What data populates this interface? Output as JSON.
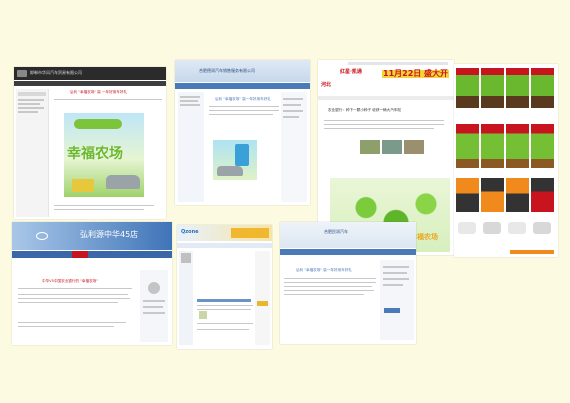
{
  "shot1": {
    "site_name": "邯郸市华风汽车贸易有限公司",
    "headline": "弘利 \"幸福农场\" 赢 一年好用车好礼",
    "banner_title": "幸福农场"
  },
  "shot2": {
    "site_name": "合肥德润汽车销售服务有限公司",
    "headline": "弘利 \"幸福农场\" 赢一年好用车好礼"
  },
  "shot3": {
    "logo": "红星·凯通",
    "banner_text": "11月22日 盛大开",
    "headline": "农业银行：种下一颗小种子 收获一辆大汽车啦",
    "watermark": "幸福农场"
  },
  "shot5": {
    "dealer_name": "弘利源中华45店",
    "headline": "中华V5中国农业银行的 \"幸福农场\""
  },
  "shot6": {
    "logo_text": "Qzone"
  },
  "shot7": {
    "site_name": "合肥民润汽车",
    "headline": "弘利 \"幸福农场\" 赢一年好用车好礼"
  },
  "colors": {
    "background": "#fcfbe1",
    "dark_header": "#2b2b2b",
    "blue_header": "#4a7ab8",
    "red_brand": "#c8141e",
    "farm_green": "#6ab82e",
    "farm_orange": "#f08a1c"
  }
}
